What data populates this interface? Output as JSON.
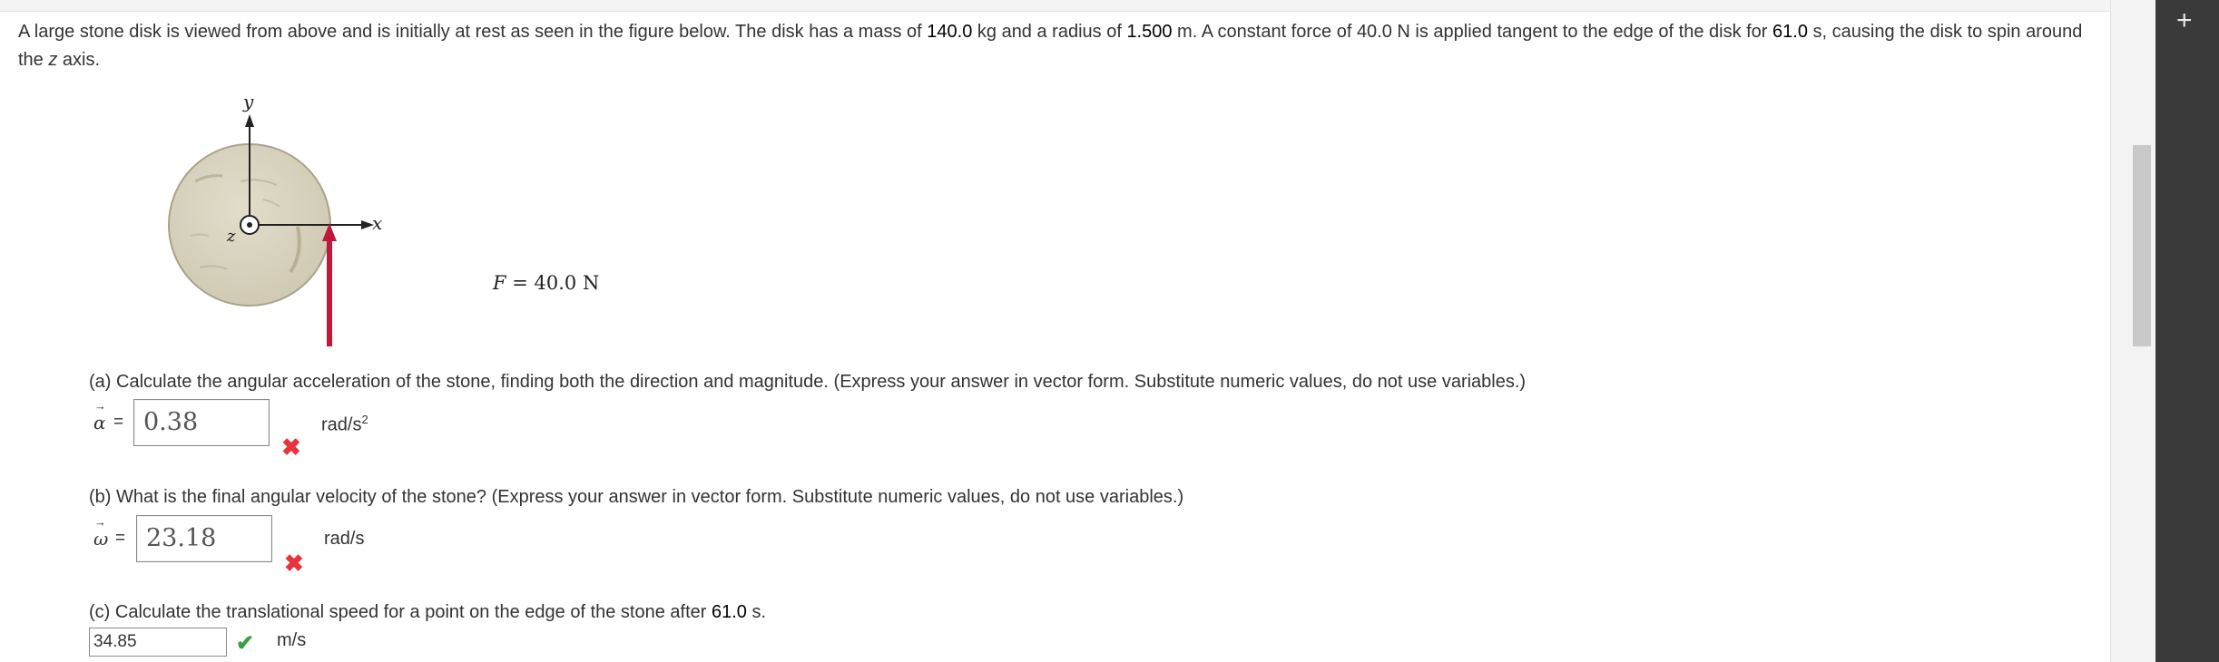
{
  "problem": {
    "text_1": "A large stone disk is viewed from above and is initially at rest as seen in the figure below. The disk has a mass of ",
    "mass": "140.0",
    "text_2": " kg and a radius of ",
    "radius": "1.500",
    "text_3": " m. A constant force of 40.0 N is applied tangent to the edge of the disk for ",
    "time": "61.0",
    "text_4": " s, causing the disk to spin around the ",
    "axis": "z",
    "text_5": " axis."
  },
  "figure": {
    "y_label": "y",
    "x_label": "x",
    "z_label": "z",
    "force_var": "F",
    "force_eq": " = 40.0 N",
    "disk_color": "#d8d3bf",
    "arrow_color": "#c0183b"
  },
  "part_a": {
    "question": "(a) Calculate the angular acceleration of the stone, finding both the direction and magnitude. (Express your answer in vector form. Substitute numeric values, do not use variables.)",
    "symbol": "α",
    "equals": "=",
    "value": "0.38",
    "unit": "rad/s",
    "unit_sup": "2",
    "status": "incorrect"
  },
  "part_b": {
    "question": "(b) What is the final angular velocity of the stone? (Express your answer in vector form. Substitute numeric values, do not use variables.)",
    "symbol": "ω",
    "equals": "=",
    "value": "23.18",
    "unit": "rad/s",
    "status": "incorrect"
  },
  "part_c": {
    "question_1": "(c) Calculate the translational speed for a point on the edge of the stone after ",
    "time": "61.0",
    "question_2": " s.",
    "value": "34.85",
    "unit": "m/s",
    "status": "correct"
  },
  "icons": {
    "incorrect": "✖",
    "correct": "✔",
    "plus": "+",
    "vector_arrow": "→"
  }
}
